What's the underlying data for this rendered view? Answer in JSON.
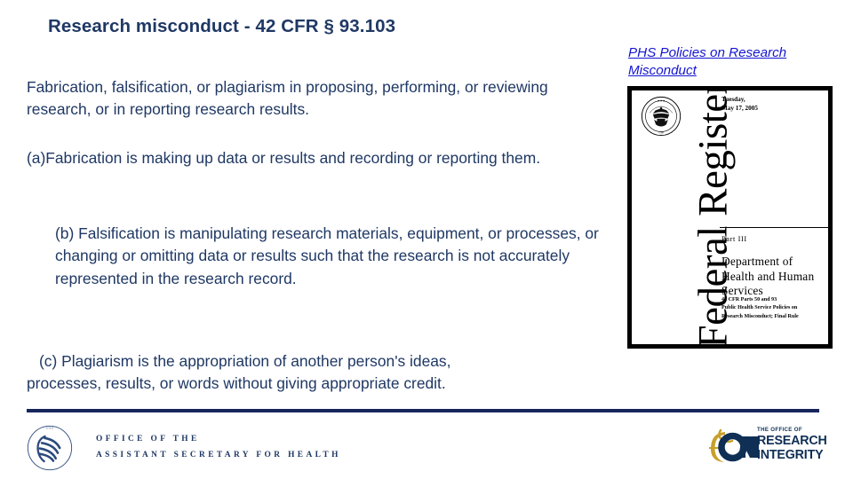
{
  "slide": {
    "title": "Research misconduct - 42 CFR § 93.103",
    "intro": "Fabrication, falsification, or plagiarism in proposing, performing, or reviewing research, or in reporting research results.",
    "definitions": {
      "a": "(a)Fabrication is making up data or results and recording or reporting them.",
      "b": "(b) Falsification is manipulating research materials, equipment, or processes, or changing or omitting data or results such that the research is not accurately represented in the research record.",
      "c_line1": "(c) Plagiarism is the appropriation of another person's ideas,",
      "c_line2": "processes, results, or words without giving appropriate credit."
    }
  },
  "link": {
    "label": "PHS Policies on Research Misconduct",
    "color": "#1414d2"
  },
  "federal_register": {
    "masthead": "Federal Register",
    "date_line1": "Tuesday,",
    "date_line2": "May 17, 2005",
    "part": "Part III",
    "department_line1": "Department of",
    "department_line2": "Health and Human",
    "department_line3": "Services",
    "cfr_line1": "42 CFR Parts 50 and 93",
    "cfr_line2": "Public Health Service Policies on",
    "cfr_line3": "Research Misconduct; Final Rule",
    "seal_name": "great-seal-of-the-united-states"
  },
  "footer": {
    "office_line1": "OFFICE OF THE",
    "office_line2": "ASSISTANT SECRETARY FOR HEALTH",
    "hhs_seal_name": "hhs-department-seal",
    "ori": {
      "mark": "ORI",
      "small": "THE OFFICE OF",
      "line1": "RESEARCH",
      "line2": "INTEGRITY",
      "gold": "#c8a02a",
      "navy": "#0f2f55"
    },
    "rule_color": "#16265c"
  },
  "theme": {
    "text_navy": "#1f3864",
    "background": "#ffffff"
  }
}
